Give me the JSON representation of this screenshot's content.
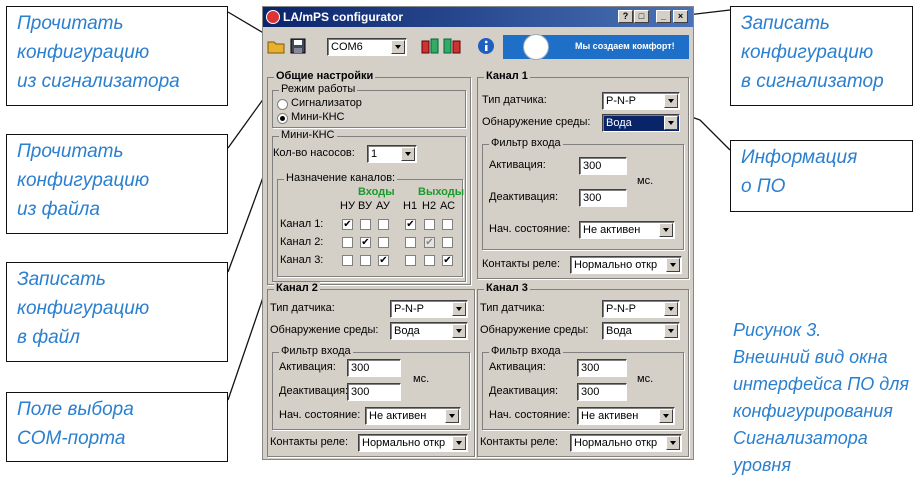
{
  "window": {
    "title": "LA/mPS configurator",
    "toolbar": {
      "com_port": "COM6",
      "slogan": "Мы создаем комфорт!"
    },
    "general": {
      "title": "Общие настройки",
      "mode_title": "Режим работы",
      "mode_options": [
        "Сигнализатор",
        "Мини-КНС"
      ],
      "mini_kns_title": "Мини-КНС",
      "pump_count_label": "Кол-во насосов:",
      "pump_count_value": "1",
      "channels_assign_title": "Назначение каналов:",
      "inputs_label": "Входы",
      "outputs_label": "Выходы",
      "columns": [
        "НУ",
        "ВУ",
        "АУ",
        "Н1",
        "Н2",
        "АС"
      ],
      "rows": [
        {
          "label": "Канал 1:",
          "checks": [
            "✔",
            "",
            "",
            "✔",
            "",
            ""
          ]
        },
        {
          "label": "Канал 2:",
          "checks": [
            "",
            "✔",
            "",
            "",
            "✔",
            ""
          ]
        },
        {
          "label": "Канал 3:",
          "checks": [
            "",
            "",
            "✔",
            "",
            "",
            "✔"
          ]
        }
      ]
    },
    "channels": [
      {
        "title": "Канал 1",
        "sensor_label": "Тип датчика:",
        "sensor_value": "P-N-P",
        "medium_label": "Обнаружение среды:",
        "medium_value": "Вода",
        "filter_title": "Фильтр входа",
        "activation_label": "Активация:",
        "activation_value": "300",
        "deactivation_label": "Деактивация:",
        "deactivation_value": "300",
        "unit": "мс.",
        "initial_state_label": "Нач. состояние:",
        "initial_state_value": "Не активен",
        "relay_label": "Контакты реле:",
        "relay_value": "Нормально откр"
      },
      {
        "title": "Канал 2",
        "sensor_label": "Тип датчика:",
        "sensor_value": "P-N-P",
        "medium_label": "Обнаружение среды:",
        "medium_value": "Вода",
        "filter_title": "Фильтр входа",
        "activation_label": "Активация:",
        "activation_value": "300",
        "deactivation_label": "Деактивация:",
        "deactivation_value": "300",
        "unit": "мс.",
        "initial_state_label": "Нач. состояние:",
        "initial_state_value": "Не активен",
        "relay_label": "Контакты реле:",
        "relay_value": "Нормально откр"
      },
      {
        "title": "Канал 3",
        "sensor_label": "Тип датчика:",
        "sensor_value": "P-N-P",
        "medium_label": "Обнаружение среды:",
        "medium_value": "Вода",
        "filter_title": "Фильтр входа",
        "activation_label": "Активация:",
        "activation_value": "300",
        "deactivation_label": "Деактивация:",
        "deactivation_value": "300",
        "unit": "мс.",
        "initial_state_label": "Нач. состояние:",
        "initial_state_value": "Не активен",
        "relay_label": "Контакты реле:",
        "relay_value": "Нормально откр"
      }
    ]
  },
  "callouts": {
    "read_device": [
      "Прочитать",
      "конфигурацию",
      "из сигнализатора"
    ],
    "read_file": [
      "Прочитать",
      "конфигурацию",
      "из файла"
    ],
    "write_file": [
      "Записать",
      "конфигурацию",
      "в файл"
    ],
    "com_port": [
      "Поле выбора",
      "COM-порта"
    ],
    "write_device": [
      "Записать",
      "конфигурацию",
      "в сигнализатор"
    ],
    "info": [
      "Информация",
      "о ПО"
    ]
  },
  "caption": [
    "Рисунок 3.",
    "Внешний вид окна",
    "интерфейса ПО для",
    "конфигурирования",
    "Сигнализатора",
    "уровня"
  ]
}
